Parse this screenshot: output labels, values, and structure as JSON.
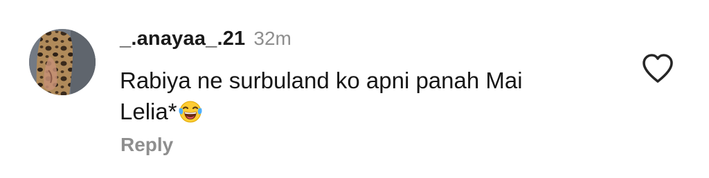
{
  "comment": {
    "username": "_.anayaa_.21",
    "timestamp": "32m",
    "text_line_1": "Rabiya ne surbuland ko apni panah Mai",
    "text_line_2": "Lelia*",
    "emoji": "laughing-with-tears",
    "reply_label": "Reply",
    "like_icon": "heart-outline-icon"
  },
  "colors": {
    "text": "#161616",
    "muted": "#8e8e8e",
    "heart_stroke": "#262626"
  }
}
